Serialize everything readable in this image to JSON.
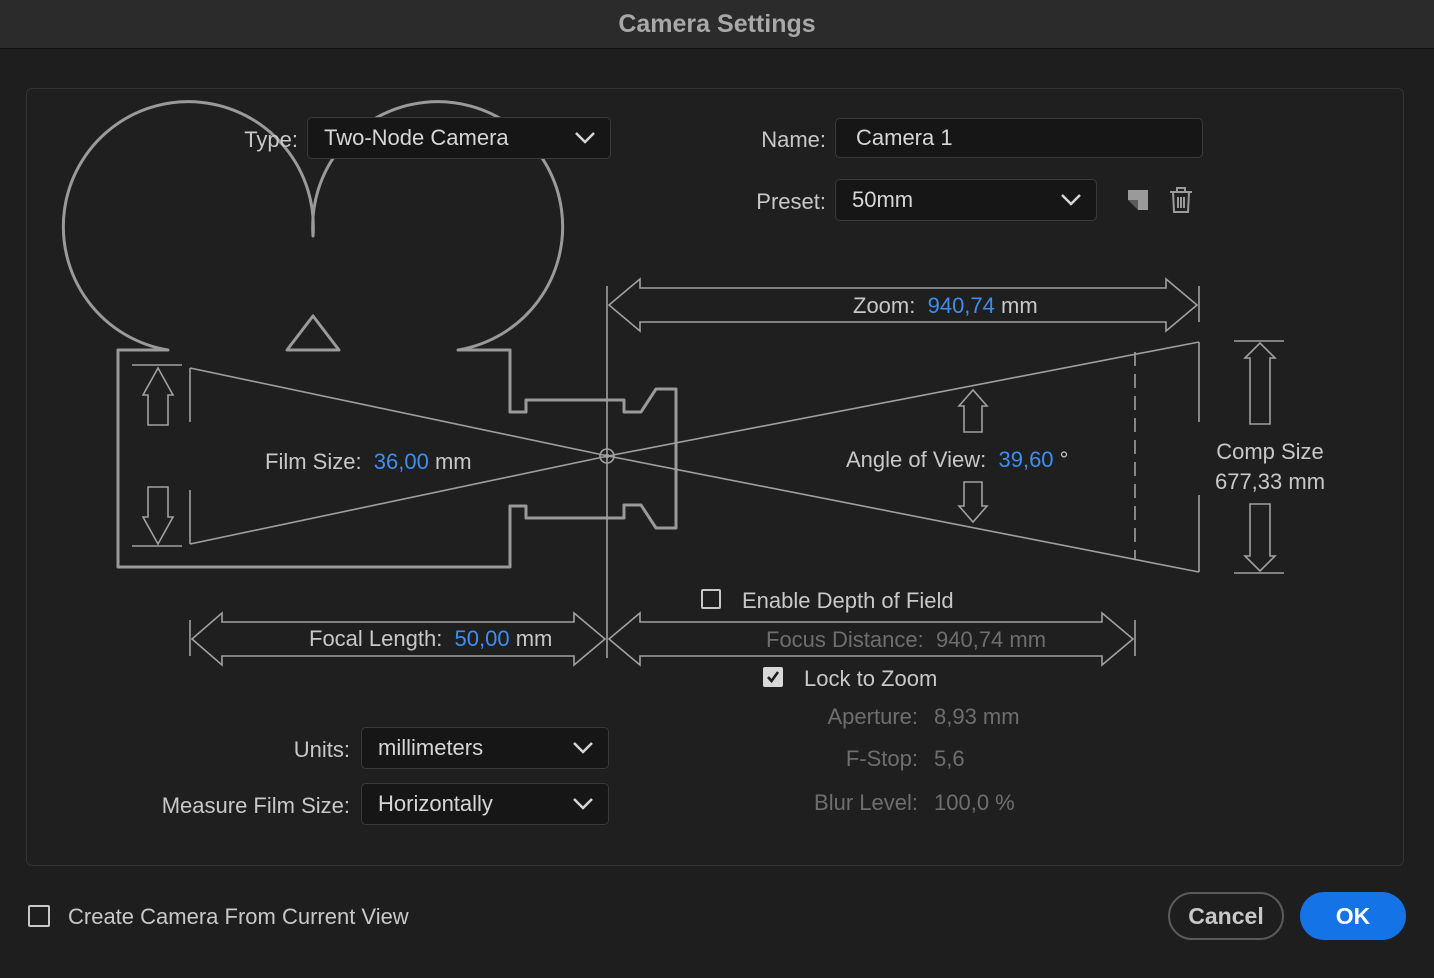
{
  "window": {
    "title": "Camera Settings"
  },
  "type": {
    "label": "Type:",
    "value": "Two-Node Camera"
  },
  "name": {
    "label": "Name:",
    "value": "Camera 1"
  },
  "preset": {
    "label": "Preset:",
    "value": "50mm"
  },
  "zoom": {
    "label": "Zoom:",
    "value": "940,74",
    "unit": "mm"
  },
  "film_size": {
    "label": "Film Size:",
    "value": "36,00",
    "unit": "mm"
  },
  "angle_of_view": {
    "label": "Angle of View:",
    "value": "39,60",
    "unit": "°"
  },
  "comp_size": {
    "label": "Comp Size",
    "value": "677,33 mm"
  },
  "focal_length": {
    "label": "Focal Length:",
    "value": "50,00",
    "unit": "mm"
  },
  "depth_of_field": {
    "label": "Enable Depth of Field",
    "checked": false
  },
  "focus_distance": {
    "label": "Focus Distance:",
    "value": "940,74 mm"
  },
  "lock_to_zoom": {
    "label": "Lock to Zoom",
    "checked": true
  },
  "aperture": {
    "label": "Aperture:",
    "value": "8,93 mm"
  },
  "fstop": {
    "label": "F-Stop:",
    "value": "5,6"
  },
  "blur_level": {
    "label": "Blur Level:",
    "value": "100,0 %"
  },
  "units": {
    "label": "Units:",
    "value": "millimeters"
  },
  "measure_film_size": {
    "label": "Measure Film Size:",
    "value": "Horizontally"
  },
  "create_from_view": {
    "label": "Create Camera From Current View",
    "checked": false
  },
  "buttons": {
    "cancel": "Cancel",
    "ok": "OK"
  },
  "colors": {
    "accent": "#1473e6",
    "value_blue": "#3d8ef2"
  }
}
